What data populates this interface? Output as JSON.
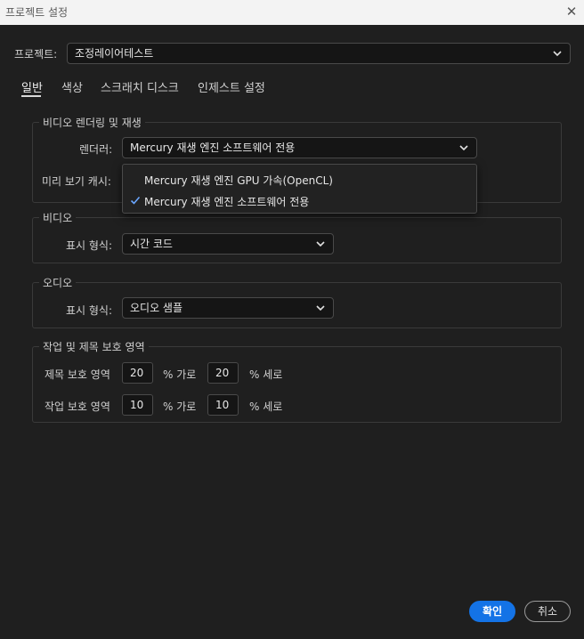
{
  "window": {
    "title": "프로젝트 설정",
    "close_symbol": "✕"
  },
  "project": {
    "label": "프로젝트:",
    "value": "조정레이어테스트"
  },
  "tabs": [
    {
      "label": "일반",
      "active": true
    },
    {
      "label": "색상",
      "active": false
    },
    {
      "label": "스크래치 디스크",
      "active": false
    },
    {
      "label": "인제스트 설정",
      "active": false
    }
  ],
  "video_rendering": {
    "legend": "비디오 렌더링 및 재생",
    "renderer_label": "렌더러:",
    "renderer_value": "Mercury 재생 엔진 소프트웨어 전용",
    "preview_cache_label": "미리 보기 캐시:",
    "dropdown_options": [
      {
        "label": "Mercury 재생 엔진 GPU 가속(OpenCL)",
        "checked": false
      },
      {
        "label": "Mercury 재생 엔진 소프트웨어 전용",
        "checked": true
      }
    ]
  },
  "video": {
    "legend": "비디오",
    "display_format_label": "표시 형식:",
    "display_format_value": "시간 코드"
  },
  "audio": {
    "legend": "오디오",
    "display_format_label": "표시 형식:",
    "display_format_value": "오디오 샘플"
  },
  "safe_areas": {
    "legend": "작업 및 제목 보호 영역",
    "title_safe": {
      "label": "제목 보호 영역",
      "horizontal": "20",
      "horizontal_unit": "% 가로",
      "vertical": "20",
      "vertical_unit": "% 세로"
    },
    "action_safe": {
      "label": "작업 보호 영역",
      "horizontal": "10",
      "horizontal_unit": "% 가로",
      "vertical": "10",
      "vertical_unit": "% 세로"
    }
  },
  "buttons": {
    "ok": "확인",
    "cancel": "취소"
  },
  "colors": {
    "accent": "#1473e6",
    "background": "#1f1f1f"
  }
}
